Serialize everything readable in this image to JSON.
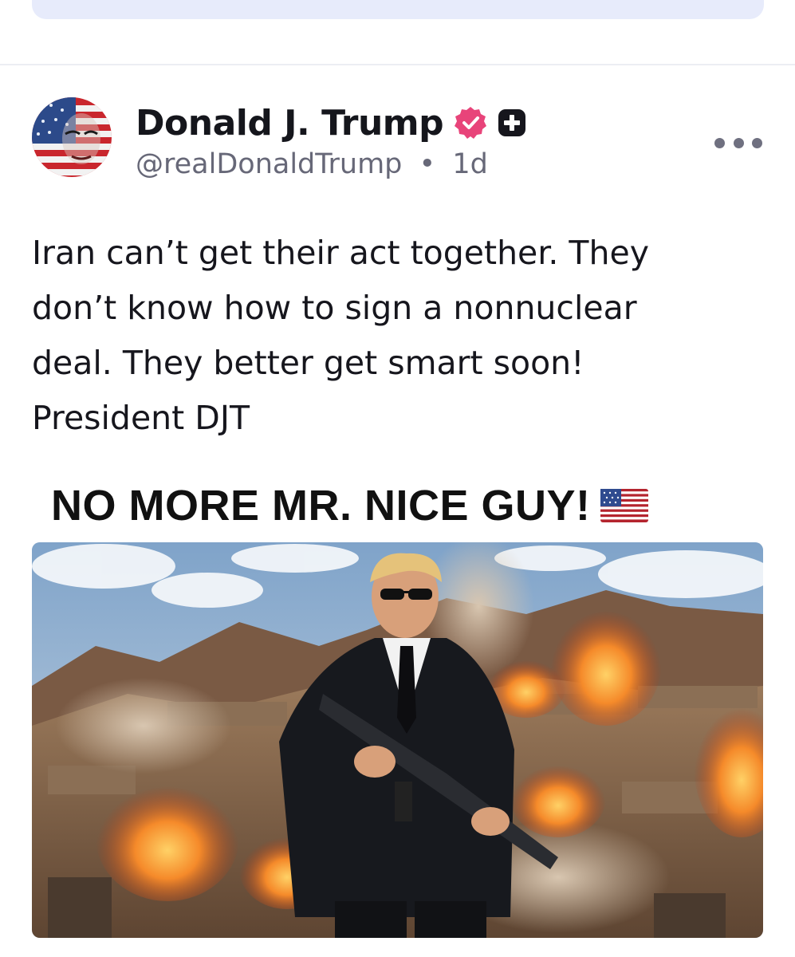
{
  "post": {
    "author": {
      "display_name": "Donald J. Trump",
      "handle": "@realDonaldTrump",
      "timestamp": "1d",
      "separator": "•",
      "verified_icon": "verified-badge-icon",
      "plus_icon": "plus-badge-icon",
      "avatar": "avatar-flag-portrait"
    },
    "text_lines": [
      "Iran can’t get their act together. They",
      "don’t know how to sign a nonnuclear",
      "deal. They better get smart soon!",
      "President DJT"
    ],
    "image": {
      "headline": "NO MORE MR. NICE GUY!",
      "flag_icon": "us-flag-emoji-icon",
      "scene": "man-in-suit-with-rifle-explosions-desert"
    }
  },
  "colors": {
    "verified": "#e8447a",
    "text": "#16161d",
    "secondary": "#676878",
    "top_bar": "#e7ebfb",
    "divider": "#eceef3"
  }
}
